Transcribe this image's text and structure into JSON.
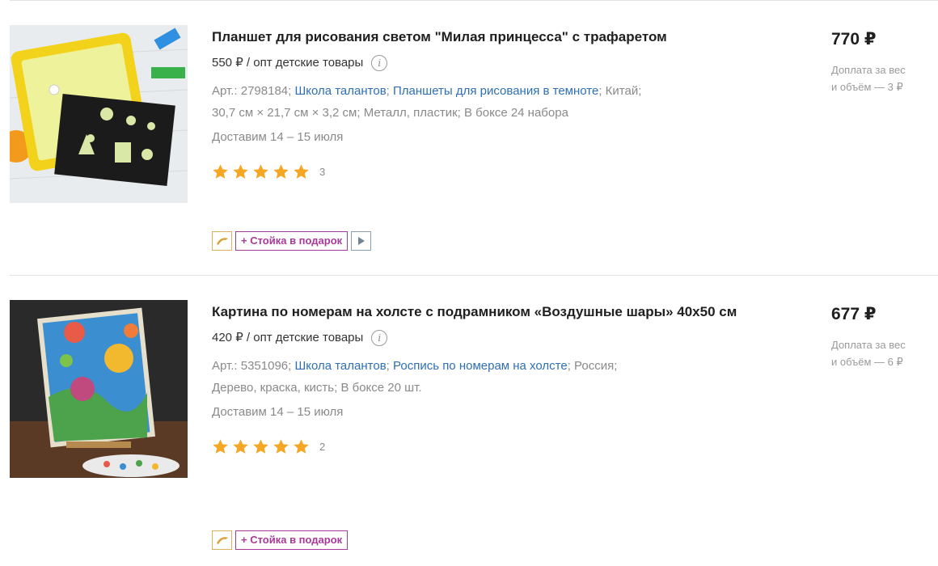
{
  "products": [
    {
      "title": "Планшет для рисования светом \"Милая принцесса\" с трафаретом",
      "wholesale": "550 ₽ / опт детские товары",
      "article": "Арт.: 2798184;",
      "brand": "Школа талантов",
      "category": "Планшеты для рисования в темноте",
      "country": "Китай;",
      "dimensions": "30,7 см × 21,7 см × 3,2 см;",
      "material": "Металл, пластик;",
      "box": "В боксе 24 набора",
      "delivery": "Доставим 14 – 15 июля",
      "rating": 5,
      "reviews": "3",
      "gift_label": "+ Стойка в подарок",
      "price": "770 ₽",
      "surcharge_line1": "Доплата за вес",
      "surcharge_line2": "и объём — 3 ₽"
    },
    {
      "title": "Картина по номерам на холсте с подрамником «Воздушные шары» 40х50 см",
      "wholesale": "420 ₽ / опт детские товары",
      "article": "Арт.: 5351096;",
      "brand": "Школа талантов",
      "category": "Роспись по номерам на холсте",
      "country": "Россия;",
      "material": "Дерево, краска, кисть;",
      "box": "В боксе 20 шт.",
      "delivery": "Доставим 14 – 15 июля",
      "rating": 5,
      "reviews": "2",
      "gift_label": "+ Стойка в подарок",
      "price": "677 ₽",
      "surcharge_line1": "Доплата за вес",
      "surcharge_line2": "и объём — 6 ₽"
    }
  ],
  "colors": {
    "link": "#2e6fb7",
    "star": "#f5a623",
    "gift_badge": "#a8399b",
    "wholesale_badge": "#d9b25b"
  }
}
